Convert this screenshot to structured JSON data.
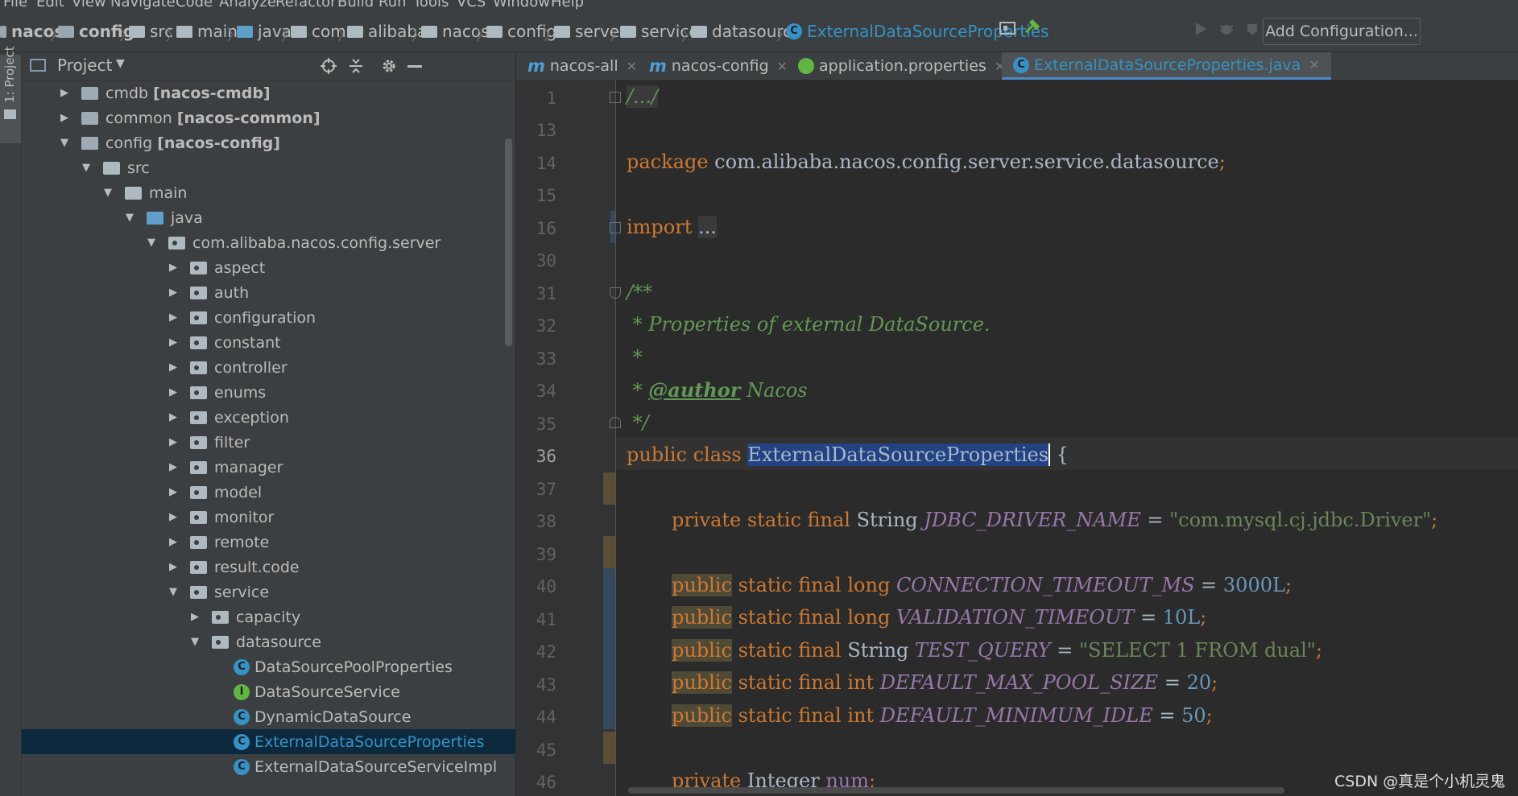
{
  "menu": [
    "File",
    "Edit",
    "View",
    "Navigate",
    "Code",
    "Analyze",
    "Refactor",
    "Build",
    "Run",
    "Tools",
    "VCS",
    "Window",
    "Help"
  ],
  "breadcrumbs": [
    "nacos",
    "config",
    "src",
    "main",
    "java",
    "com",
    "alibaba",
    "nacos",
    "config",
    "server",
    "service",
    "datasource",
    "ExternalDataSourceProperties"
  ],
  "toolbar": {
    "add_configuration": "Add Configuration..."
  },
  "toolstrip": {
    "project_label": "1: Project"
  },
  "project_panel": {
    "title": "Project",
    "tree": [
      {
        "label": "cmdb",
        "module": "[nacos-cmdb]"
      },
      {
        "label": "common",
        "module": "[nacos-common]"
      },
      {
        "label": "config",
        "module": "[nacos-config]"
      },
      {
        "label": "src"
      },
      {
        "label": "main"
      },
      {
        "label": "java"
      },
      {
        "label": "com.alibaba.nacos.config.server"
      },
      {
        "label": "aspect"
      },
      {
        "label": "auth"
      },
      {
        "label": "configuration"
      },
      {
        "label": "constant"
      },
      {
        "label": "controller"
      },
      {
        "label": "enums"
      },
      {
        "label": "exception"
      },
      {
        "label": "filter"
      },
      {
        "label": "manager"
      },
      {
        "label": "model"
      },
      {
        "label": "monitor"
      },
      {
        "label": "remote"
      },
      {
        "label": "result.code"
      },
      {
        "label": "service"
      },
      {
        "label": "capacity"
      },
      {
        "label": "datasource"
      },
      {
        "label": "DataSourcePoolProperties"
      },
      {
        "label": "DataSourceService"
      },
      {
        "label": "DynamicDataSource"
      },
      {
        "label": "ExternalDataSourceProperties"
      },
      {
        "label": "ExternalDataSourceServiceImpl"
      }
    ]
  },
  "tabs": [
    "nacos-all",
    "nacos-config",
    "application.properties",
    "ExternalDataSourceProperties.java"
  ],
  "line_numbers": [
    "1",
    "13",
    "14",
    "15",
    "16",
    "30",
    "31",
    "32",
    "33",
    "34",
    "35",
    "36",
    "37",
    "38",
    "39",
    "40",
    "41",
    "42",
    "43",
    "44",
    "45",
    "46"
  ],
  "code": {
    "l1": "/.../",
    "package_kw": "package",
    "package_name": "com.alibaba.nacos.config.server.service.datasource",
    "semicolon": ";",
    "import_kw": "import",
    "import_dots": "...",
    "doc_open": "/**",
    "doc_line": " * Properties of external DataSource.",
    "doc_star": " *",
    "doc_author_pre": " * ",
    "doc_author_tag": "@author",
    "doc_author_val": " Nacos",
    "doc_close": " */",
    "class_kw": "public class ",
    "class_name": "ExternalDataSourceProperties",
    "class_brace": " {",
    "l38_mod": "private static final ",
    "l38_type": "String ",
    "l38_name": "JDBC_DRIVER_NAME",
    "l38_eq": " = ",
    "l38_val": "\"com.mysql.cj.jdbc.Driver\"",
    "public_kw": "public",
    "sf": " static final ",
    "l40_type": "long ",
    "l40_name": "CONNECTION_TIMEOUT_MS",
    "l40_val": "3000L",
    "l41_type": "long ",
    "l41_name": "VALIDATION_TIMEOUT",
    "l41_val": "10L",
    "l42_type": "String ",
    "l42_name": "TEST_QUERY",
    "l42_val": "\"SELECT 1 FROM dual\"",
    "l43_type": "int ",
    "l43_name": "DEFAULT_MAX_POOL_SIZE",
    "l43_val": "20",
    "l44_type": "int ",
    "l44_name": "DEFAULT_MINIMUM_IDLE",
    "l44_val": "50",
    "eq": " = ",
    "l46_mod": "private ",
    "l46_type": "Integer ",
    "l46_name": "num",
    "l46_end": ";"
  },
  "watermark": "CSDN @真是个小机灵鬼",
  "colors": {
    "keyword": "#cc7832",
    "comment": "#629755",
    "string": "#6a8759",
    "number": "#6897bb",
    "constant": "#9876aa",
    "selection": "#214283",
    "accent": "#3592c4"
  }
}
